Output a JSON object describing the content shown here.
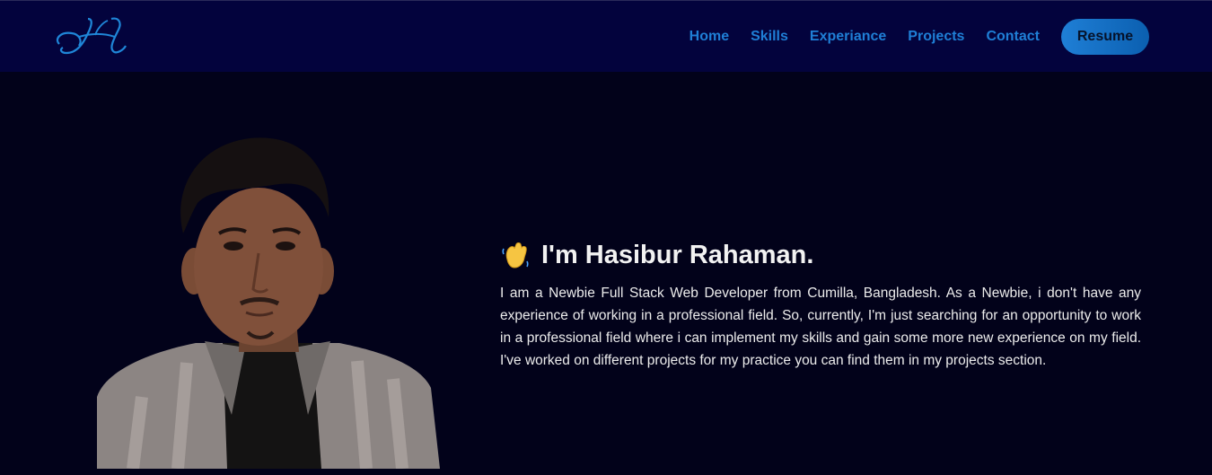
{
  "nav": {
    "logo_icon": "h-monogram-logo",
    "links": [
      "Home",
      "Skills",
      "Experiance",
      "Projects",
      "Contact"
    ],
    "resume_label": "Resume",
    "link_color": "#1f7fd6",
    "background": "#03033d"
  },
  "hero": {
    "wave_icon": "waving-hand-icon",
    "name_heading": "I'm Hasibur Rahaman.",
    "bio": "I am a Newbie Full Stack Web Developer from Cumilla, Bangladesh. As a Newbie, i don't have any experience of working in a professional field. So, currently, I'm just searching for an opportunity to work in a professional field where i can implement my skills and gain some more new experience on my field. I've worked on different projects for my practice you can find them in my projects section.",
    "photo": "portrait-photo",
    "background": "#02021a"
  }
}
